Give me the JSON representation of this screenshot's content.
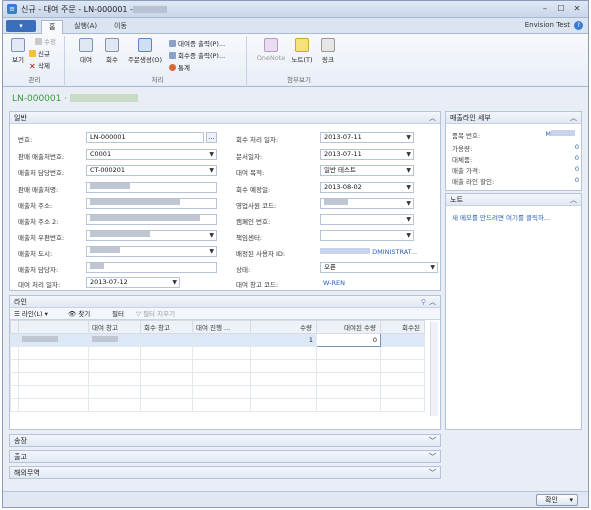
{
  "window": {
    "title": "신규 - 대여 주문 - LN-000001 -",
    "minimize": "–",
    "maximize": "☐",
    "close": "✕"
  },
  "tabs": {
    "menu_button": "▾",
    "home": "홈",
    "actions": "실행(A)",
    "navigate": "이동",
    "company": "Envision Test",
    "help": "?"
  },
  "ribbon": {
    "manage": {
      "label": "관리",
      "view": "보기",
      "edit": "수정",
      "new": "신규",
      "delete": "삭제"
    },
    "process": {
      "label": "처리",
      "rent": "대여",
      "return": "회수",
      "create_order": "주문생성(O)",
      "rent_shipment_print": "대여증 출력(P)...",
      "return_shipment_print": "회수증 출력(P)...",
      "stats": "통계"
    },
    "attach": {
      "label": "첨부보기",
      "onenote": "OneNote",
      "notes": "노트(T)",
      "links": "링크"
    }
  },
  "record_title": "LN-000001 ·",
  "general": {
    "header": "일반",
    "left_labels": [
      "번호:",
      "판매 매출처번호:",
      "매출처 담당번호:",
      "판매 매출처명:",
      "매출처 주소:",
      "매출처 주소 2:",
      "매출처 우편번호:",
      "매출처 도시:",
      "매출처 담당자:",
      "대여 처리 일자:"
    ],
    "no": "LN-000001",
    "ellipsis": "...",
    "customer_no": "C0001",
    "contact_no": "CT-000201",
    "rent_date": "2013-07-12",
    "right_labels": [
      "회수 처리 일자:",
      "문서일자:",
      "대여 목적:",
      "회수 예정일:",
      "영업사원 코드:",
      "캠페인 번호:",
      "책임센터:",
      "배정된 사용자 ID:",
      "상태:",
      "대여 창고 코드:"
    ],
    "return_date": "2013-07-11",
    "doc_date": "2013-07-11",
    "purpose": "일반 테스트",
    "expected_return": "2013-08-02",
    "assigned_user": "DMINISTRAT...",
    "status": "오픈",
    "location": "W-REN"
  },
  "factbox": {
    "header": "매출라인 세부",
    "rows": [
      {
        "label": "품목 번호:",
        "value": "M"
      },
      {
        "label": "가용량:",
        "value": "0"
      },
      {
        "label": "대체품:",
        "value": "0"
      },
      {
        "label": "매출 가격:",
        "value": "0"
      },
      {
        "label": "매출 라인 할인:",
        "value": "0"
      }
    ],
    "notes_header": "노트",
    "notes_link": "새 메모를 만드려면 여기를 클릭하..."
  },
  "lines": {
    "header": "라인",
    "toolbar": {
      "line": "라인(L)",
      "find": "찾기",
      "filter": "필터",
      "clear_filter": "필터 지우기"
    },
    "columns": [
      "",
      "대여 창고",
      "회수 창고",
      "대여 진행 ...",
      "수량",
      "대여된 수량",
      "회수된"
    ],
    "row": {
      "quantity": "1",
      "rented_qty": "0"
    }
  },
  "collapsed_tabs": [
    "송장",
    "출고",
    "해외무역"
  ],
  "ok_button": "확인"
}
